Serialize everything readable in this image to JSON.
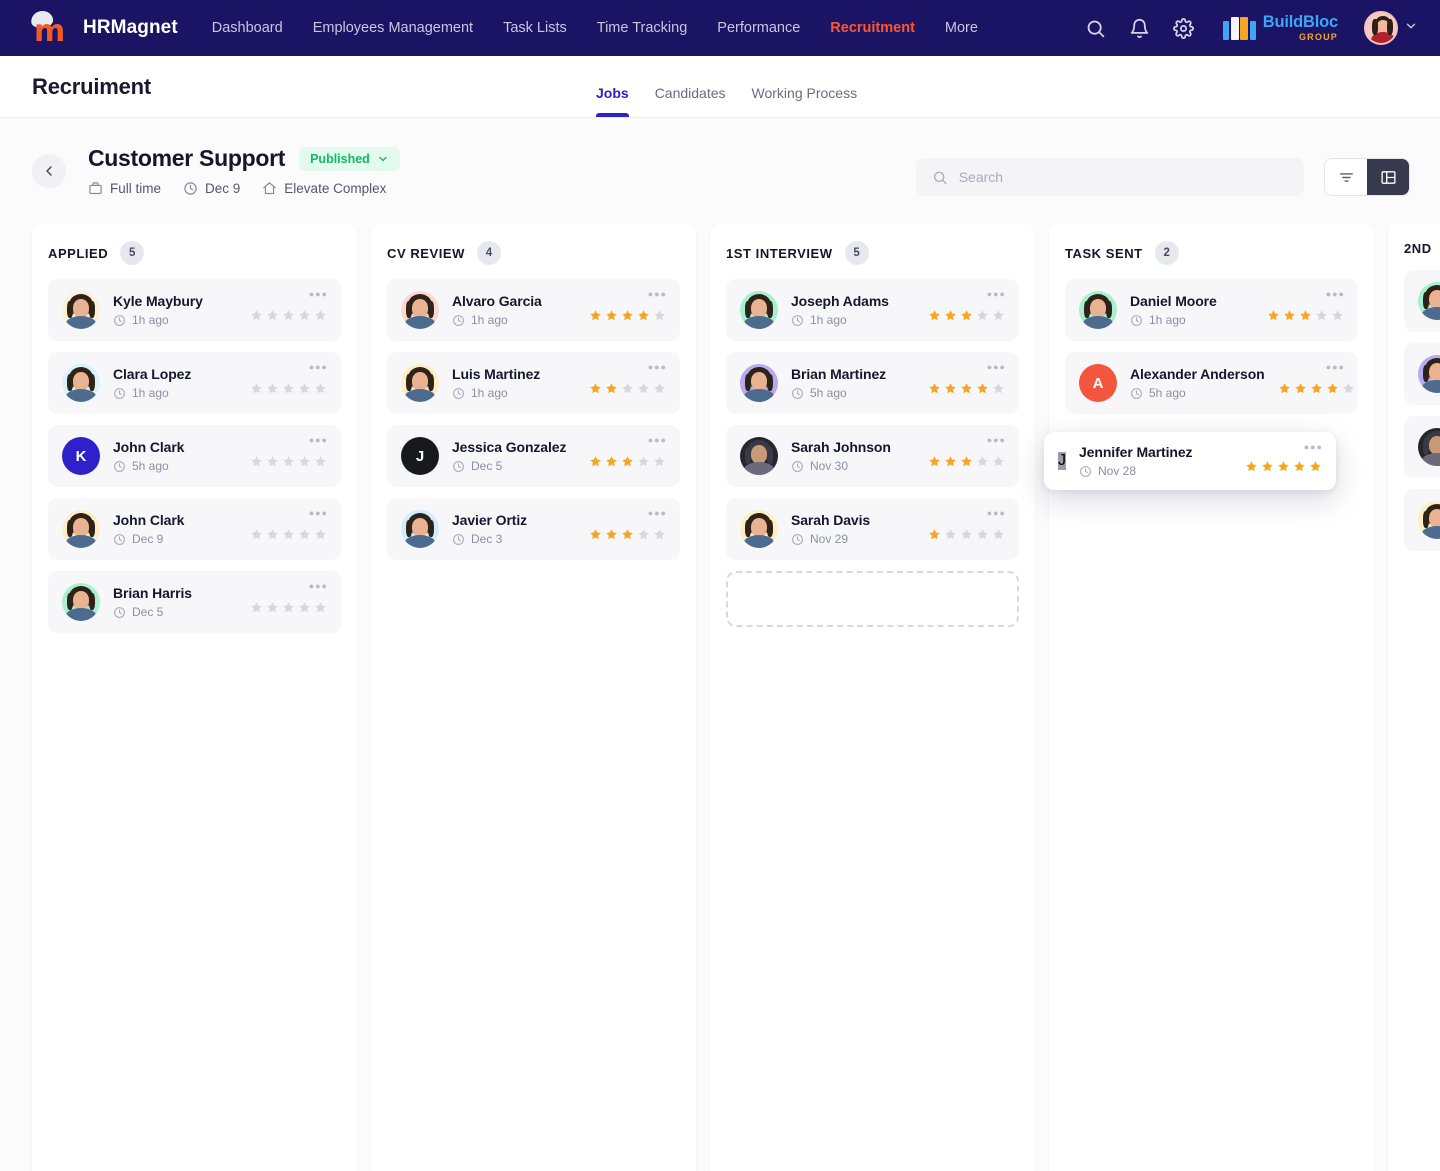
{
  "brand": {
    "name": "HRMagnet",
    "logo_icon": "hrmagnet-m-logo"
  },
  "topnav": {
    "links": [
      {
        "label": "Dashboard",
        "active": false
      },
      {
        "label": "Employees Management",
        "active": false
      },
      {
        "label": "Task Lists",
        "active": false
      },
      {
        "label": "Time Tracking",
        "active": false
      },
      {
        "label": "Performance",
        "active": false
      },
      {
        "label": "Recruitment",
        "active": true
      }
    ],
    "more_label": "More",
    "icons": [
      "search-icon",
      "bell-icon",
      "gear-icon"
    ],
    "company": {
      "name": "BuildBloc",
      "sub": "GROUP"
    }
  },
  "subheader": {
    "title": "Recruiment",
    "tabs": [
      {
        "label": "Jobs",
        "active": true
      },
      {
        "label": "Candidates",
        "active": false
      },
      {
        "label": "Working Process",
        "active": false
      }
    ]
  },
  "job": {
    "title": "Customer Support",
    "status": "Published",
    "meta": [
      {
        "icon": "briefcase-icon",
        "label": "Full time"
      },
      {
        "icon": "clock-icon",
        "label": "Dec 9"
      },
      {
        "icon": "home-icon",
        "label": "Elevate Complex"
      }
    ]
  },
  "search": {
    "placeholder": "Search",
    "value": ""
  },
  "view_toggle": {
    "filter": "filter-icon",
    "board": "board-icon",
    "active": "board"
  },
  "colors": {
    "navy": "#1b1464",
    "accent_orange": "#ff5630",
    "tab_active": "#2e21c9",
    "star_filled": "#f5a623",
    "star_empty": "#d7d7e0",
    "badge_text": "#12b76a",
    "badge_bg": "#e3fbec"
  },
  "board": {
    "columns": [
      {
        "title": "APPLIED",
        "count": "5",
        "has_dropzone": false,
        "cards": [
          {
            "name": "Kyle Maybury",
            "time": "1h ago",
            "rating": 0,
            "avatar_type": "photo",
            "avatar_bg": "#fdf0d5",
            "initial": ""
          },
          {
            "name": "Clara Lopez",
            "time": "1h ago",
            "rating": 0,
            "avatar_type": "photo",
            "avatar_bg": "#d9f2fb",
            "initial": ""
          },
          {
            "name": "John Clark",
            "time": "5h ago",
            "rating": 0,
            "avatar_type": "initial",
            "avatar_bg": "#2e21c9",
            "initial": "K"
          },
          {
            "name": "John Clark",
            "time": "Dec 9",
            "rating": 0,
            "avatar_type": "photo",
            "avatar_bg": "#fdeecb",
            "initial": ""
          },
          {
            "name": "Brian Harris",
            "time": "Dec 5",
            "rating": 0,
            "avatar_type": "photo",
            "avatar_bg": "#a8f0d0",
            "initial": ""
          }
        ]
      },
      {
        "title": "CV REVIEW",
        "count": "4",
        "has_dropzone": false,
        "cards": [
          {
            "name": "Alvaro Garcia",
            "time": "1h ago",
            "rating": 4,
            "avatar_type": "photo",
            "avatar_bg": "#fbd6d2",
            "initial": ""
          },
          {
            "name": "Luis Martinez",
            "time": "1h ago",
            "rating": 2,
            "avatar_type": "photo",
            "avatar_bg": "#fdeec4",
            "initial": ""
          },
          {
            "name": "Jessica Gonzalez",
            "time": "Dec 5",
            "rating": 3,
            "avatar_type": "initial",
            "avatar_bg": "#18181f",
            "initial": "J"
          },
          {
            "name": "Javier Ortiz",
            "time": "Dec 3",
            "rating": 3,
            "avatar_type": "photo",
            "avatar_bg": "#cfeefb",
            "initial": ""
          }
        ]
      },
      {
        "title": "1ST INTERVIEW",
        "count": "5",
        "has_dropzone": true,
        "cards": [
          {
            "name": "Joseph Adams",
            "time": "1h ago",
            "rating": 3,
            "avatar_type": "photo",
            "avatar_bg": "#a6f0cd",
            "initial": ""
          },
          {
            "name": "Brian Martinez",
            "time": "5h ago",
            "rating": 4,
            "avatar_type": "photo",
            "avatar_bg": "#b9a9f0",
            "initial": ""
          },
          {
            "name": "Sarah Johnson",
            "time": "Nov 30",
            "rating": 3,
            "avatar_type": "photo",
            "avatar_bg": "#26262e",
            "initial": ""
          },
          {
            "name": "Sarah Davis",
            "time": "Nov 29",
            "rating": 1,
            "avatar_type": "photo",
            "avatar_bg": "#fdeec4",
            "initial": ""
          }
        ]
      },
      {
        "title": "TASK SENT",
        "count": "2",
        "has_dropzone": false,
        "cards": [
          {
            "name": "Daniel Moore",
            "time": "1h ago",
            "rating": 3,
            "avatar_type": "photo",
            "avatar_bg": "#a6f0cd",
            "initial": ""
          },
          {
            "name": "Alexander Anderson",
            "time": "5h ago",
            "rating": 4,
            "avatar_type": "initial",
            "avatar_bg": "#f4553d",
            "initial": "A"
          }
        ]
      },
      {
        "title": "2ND",
        "count": "",
        "has_dropzone": false,
        "cards": [
          {
            "name": "",
            "time": "",
            "rating": 0,
            "avatar_type": "photo",
            "avatar_bg": "#a6f0cd",
            "initial": ""
          },
          {
            "name": "",
            "time": "",
            "rating": 0,
            "avatar_type": "photo",
            "avatar_bg": "#b9a9f0",
            "initial": ""
          },
          {
            "name": "",
            "time": "",
            "rating": 0,
            "avatar_type": "photo",
            "avatar_bg": "#26262e",
            "initial": ""
          },
          {
            "name": "",
            "time": "",
            "rating": 0,
            "avatar_type": "photo",
            "avatar_bg": "#fdeec4",
            "initial": ""
          }
        ]
      }
    ]
  },
  "dragged_card": {
    "name": "Jennifer Martinez",
    "time": "Nov 28",
    "rating": 5,
    "avatar_type": "initial",
    "avatar_bg": "#9b9bab",
    "initial": "J"
  }
}
